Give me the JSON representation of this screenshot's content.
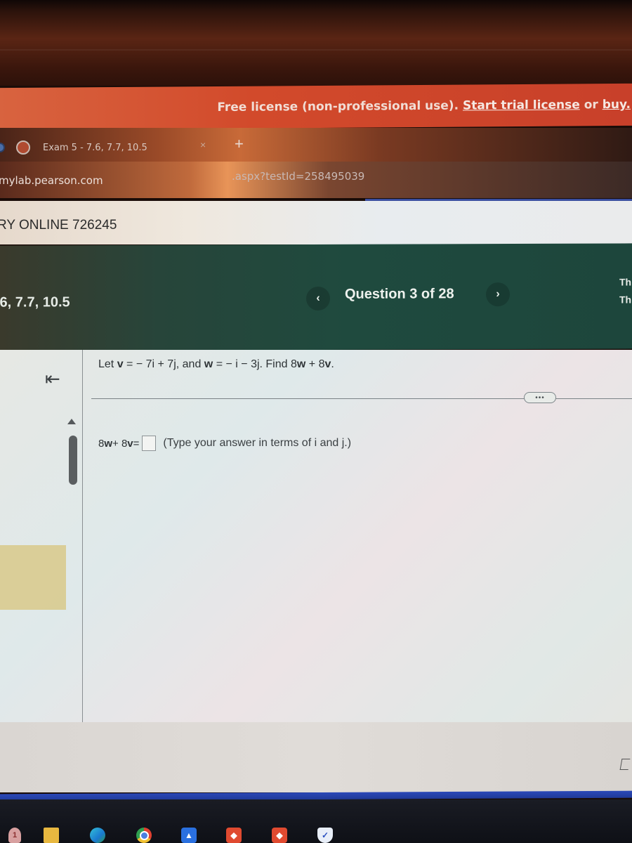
{
  "license_banner": {
    "text": "Free license (non-professional use).",
    "trial_link": "Start trial license",
    "or_text": "or",
    "buy_link": "buy."
  },
  "browser": {
    "tab": {
      "title": "Exam 5 - 7.6, 7.7, 10.5",
      "close_icon": "×"
    },
    "new_tab_icon": "+",
    "address": {
      "host": "mylab.pearson.com",
      "path_fragment": ".aspx?testId=258495039"
    }
  },
  "course": {
    "title": "RY ONLINE 726245"
  },
  "assignment": {
    "title": ".6, 7.7, 10.5",
    "question_counter": "Question 3 of 28",
    "prev_icon": "‹",
    "next_icon": "›",
    "right_cutoff_1": "Th",
    "right_cutoff_2": "Th"
  },
  "sidebar": {
    "collapse_icon": "⇤"
  },
  "question": {
    "prefix": "Let ",
    "v_label": "v",
    "v_expr": " = − 7i + 7j, and ",
    "w_label": "w",
    "w_expr": " = − i − 3j.  Find 8",
    "find_w": "w",
    "plus": " + 8",
    "find_v": "v",
    "period": ".",
    "more_button": "•••"
  },
  "answer": {
    "lhs_prefix": "8",
    "lhs_w": "w",
    "lhs_mid": " + 8",
    "lhs_v": "v",
    "lhs_eq": " =",
    "input_value": "",
    "hint": "(Type your answer in terms of i and j.)"
  },
  "taskbar": {
    "badge_count": "1",
    "icons": [
      "notification-badge",
      "file-explorer",
      "edge-browser",
      "chrome-browser",
      "app-blue",
      "app-red",
      "app-red",
      "security-shield"
    ]
  }
}
